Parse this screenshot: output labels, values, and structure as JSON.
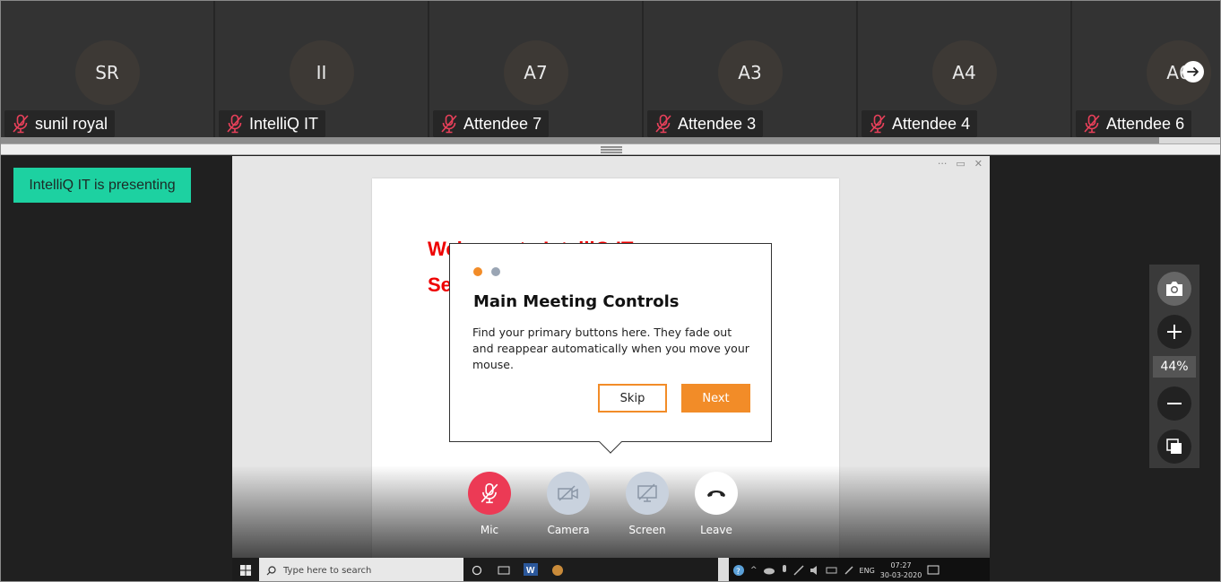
{
  "participants": [
    {
      "initials": "SR",
      "name": "sunil royal"
    },
    {
      "initials": "II",
      "name": "IntelliQ IT"
    },
    {
      "initials": "A7",
      "name": "Attendee 7"
    },
    {
      "initials": "A3",
      "name": "Attendee 3"
    },
    {
      "initials": "A4",
      "name": "Attendee 4"
    },
    {
      "initials": "A6",
      "name": "Attendee 6"
    }
  ],
  "presenting_label": "IntelliQ IT is presenting",
  "slide": {
    "line1": "Welcome to IntelliQ IT",
    "line2": "Se"
  },
  "tooltip": {
    "title": "Main Meeting Controls",
    "body": "Find your primary buttons here. They fade out and reappear automatically when you move your mouse.",
    "skip_label": "Skip",
    "next_label": "Next",
    "dot_colors": [
      "#f28c28",
      "#9aa5b4"
    ]
  },
  "controls": {
    "mic_label": "Mic",
    "camera_label": "Camera",
    "screen_label": "Screen",
    "leave_label": "Leave"
  },
  "zoom": {
    "level": "44%"
  },
  "taskbar": {
    "search_placeholder": "Type here to search",
    "lang": "ENG",
    "time": "07:27",
    "date": "30-03-2020"
  },
  "colors": {
    "presenting_bg": "#1dd1a1",
    "accent_orange": "#f28c28",
    "mic_red": "#ec3a55",
    "muted_icon": "#e8405a"
  }
}
